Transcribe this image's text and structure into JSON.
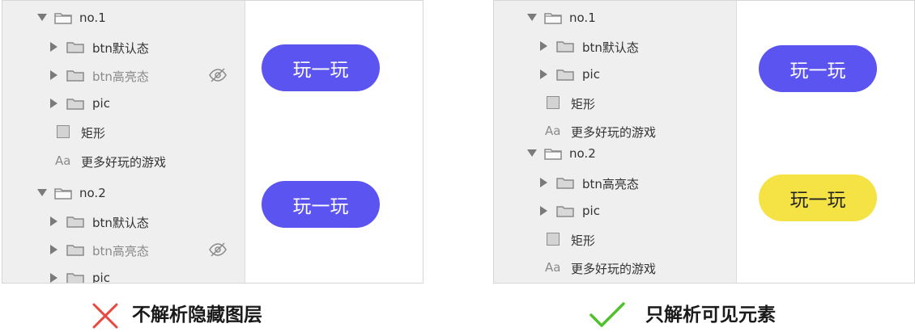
{
  "left_panel": {
    "rows": [
      {
        "label": "no.1",
        "kind": "folder",
        "state": "open",
        "hidden": false
      },
      {
        "label": "btn默认态",
        "kind": "folder",
        "state": "closed",
        "hidden": false
      },
      {
        "label": "btn高亮态",
        "kind": "folder",
        "state": "closed",
        "hidden": true
      },
      {
        "label": "pic",
        "kind": "folder",
        "state": "closed",
        "hidden": false
      },
      {
        "label": "矩形",
        "kind": "rect",
        "hidden": false
      },
      {
        "label": "更多好玩的游戏",
        "kind": "text",
        "hidden": false
      },
      {
        "label": "no.2",
        "kind": "folder",
        "state": "open",
        "hidden": false
      },
      {
        "label": "btn默认态",
        "kind": "folder",
        "state": "closed",
        "hidden": false
      },
      {
        "label": "btn高亮态",
        "kind": "folder",
        "state": "closed",
        "hidden": true
      },
      {
        "label": "pic",
        "kind": "folder",
        "state": "closed",
        "hidden": false
      }
    ],
    "buttons": [
      {
        "label": "玩一玩",
        "color": "#5b54f1",
        "text_color": "#ffffff"
      },
      {
        "label": "玩一玩",
        "color": "#5b54f1",
        "text_color": "#ffffff"
      }
    ]
  },
  "right_panel": {
    "rows": [
      {
        "label": "no.1",
        "kind": "folder",
        "state": "open"
      },
      {
        "label": "btn默认态",
        "kind": "folder",
        "state": "closed"
      },
      {
        "label": "pic",
        "kind": "folder",
        "state": "closed"
      },
      {
        "label": "矩形",
        "kind": "rect"
      },
      {
        "label": "更多好玩的游戏",
        "kind": "text"
      },
      {
        "label": "no.2",
        "kind": "folder",
        "state": "open"
      },
      {
        "label": "btn高亮态",
        "kind": "folder",
        "state": "closed"
      },
      {
        "label": "pic",
        "kind": "folder",
        "state": "closed"
      },
      {
        "label": "矩形",
        "kind": "rect"
      },
      {
        "label": "更多好玩的游戏",
        "kind": "text"
      }
    ],
    "buttons": [
      {
        "label": "玩一玩",
        "color": "#5b54f1",
        "text_color": "#ffffff"
      },
      {
        "label": "玩一玩",
        "color": "#f5e346",
        "text_color": "#222222"
      }
    ]
  },
  "text_icon_glyph": "Aa",
  "captions": {
    "left": "不解析隐藏图层",
    "left_icon": "cross-icon",
    "right": "只解析可见元素",
    "right_icon": "check-icon"
  },
  "colors": {
    "cross": "#e8483f",
    "check": "#4fc12a"
  }
}
